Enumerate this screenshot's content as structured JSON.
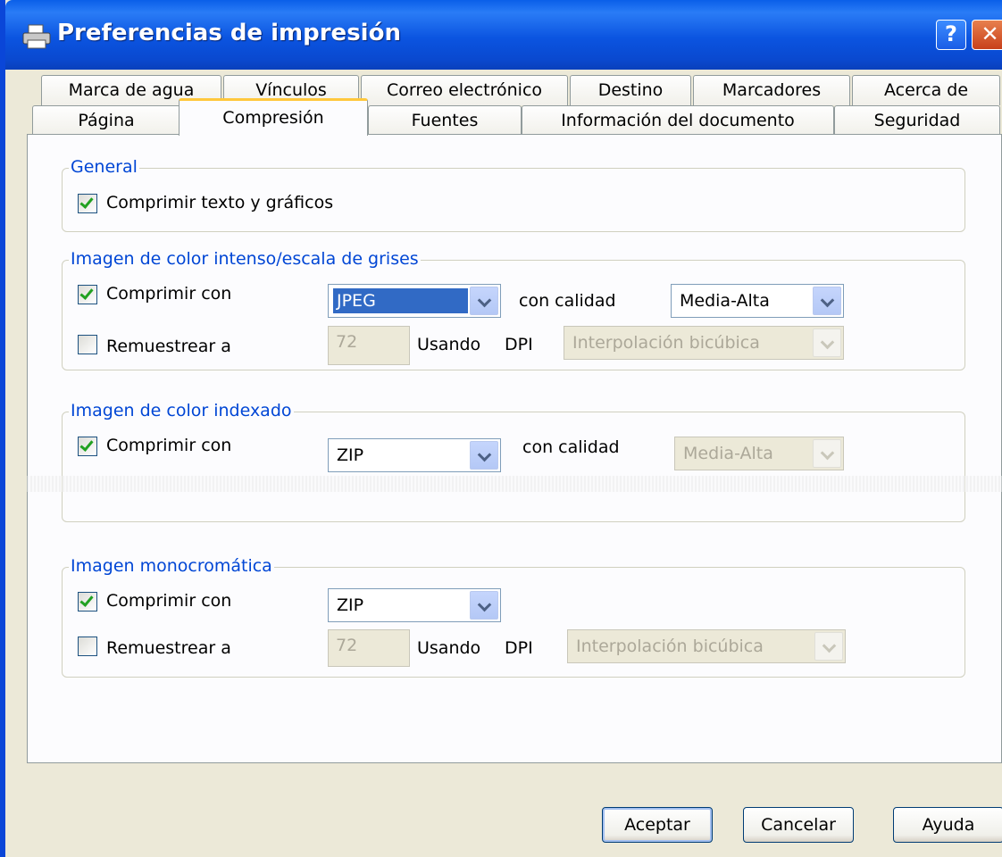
{
  "window": {
    "title": "Preferencias de impresión"
  },
  "tabs_row1": [
    "Marca de agua",
    "Vínculos",
    "Correo electrónico",
    "Destino",
    "Marcadores",
    "Acerca de"
  ],
  "tabs_row2": [
    "Página",
    "Compresión",
    "Fuentes",
    "Información del documento",
    "Seguridad"
  ],
  "active_tab": "Compresión",
  "general": {
    "legend": "General",
    "compress_label": "Comprimir texto y gráficos",
    "compress_checked": true
  },
  "color_gray": {
    "legend": "Imagen de color intenso/escala de grises",
    "compress_label": "Comprimir con",
    "compress_checked": true,
    "method": "JPEG",
    "quality_label": "con calidad",
    "quality": "Media-Alta",
    "resample_label": "Remuestrear a",
    "resample_checked": false,
    "dpi_value": "72",
    "using_label": "Usando",
    "dpi_label": "DPI",
    "interpolation": "Interpolación bicúbica"
  },
  "indexed": {
    "legend": "Imagen de color indexado",
    "compress_label": "Comprimir con",
    "compress_checked": true,
    "method": "ZIP",
    "quality_label": "con calidad",
    "quality": "Media-Alta"
  },
  "mono": {
    "legend": "Imagen monocromática",
    "compress_label": "Comprimir con",
    "compress_checked": true,
    "method": "ZIP",
    "resample_label": "Remuestrear a",
    "resample_checked": false,
    "dpi_value": "72",
    "using_label": "Usando",
    "dpi_label": "DPI",
    "interpolation": "Interpolación bicúbica"
  },
  "buttons": {
    "ok": "Aceptar",
    "cancel": "Cancelar",
    "help": "Ayuda"
  },
  "colors": {
    "title_bar": "#0a54e0",
    "group_legend": "#0046d5",
    "selection": "#316ac5",
    "check": "#21a121",
    "tab_highlight": "#ffc83c"
  }
}
